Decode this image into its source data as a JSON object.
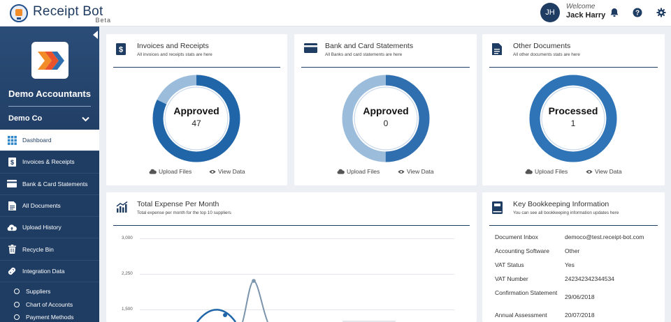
{
  "app": {
    "name": "Receipt Bot",
    "edition": "Beta"
  },
  "user": {
    "initials": "JH",
    "welcome": "Welcome",
    "name": "Jack Harry"
  },
  "header_icons": [
    "bell-icon",
    "help-icon",
    "gear-icon"
  ],
  "sidebar": {
    "company": "Demo Accountants",
    "client": "Demo Co",
    "items": [
      {
        "label": "Dashboard",
        "icon": "grid-icon",
        "active": true
      },
      {
        "label": "Invoices & Receipts",
        "icon": "invoice-icon"
      },
      {
        "label": "Bank & Card Statements",
        "icon": "card-icon"
      },
      {
        "label": "All Documents",
        "icon": "document-icon"
      },
      {
        "label": "Upload History",
        "icon": "cloud-upload-icon"
      },
      {
        "label": "Recycle Bin",
        "icon": "trash-icon"
      },
      {
        "label": "Integration Data",
        "icon": "link-icon"
      }
    ],
    "sub_items": [
      {
        "label": "Suppliers"
      },
      {
        "label": "Chart of Accounts"
      },
      {
        "label": "Payment Methods"
      }
    ]
  },
  "cards": [
    {
      "title": "Invoices and Receipts",
      "subtitle": "All invoices and receipts stats are here",
      "icon": "invoice-icon",
      "status": "Approved",
      "count": "47",
      "ring_fraction": 0.82,
      "upload": "Upload Files",
      "view": "View Data"
    },
    {
      "title": "Bank and Card Statements",
      "subtitle": "All Banks and card statements are here",
      "icon": "card-icon",
      "status": "Approved",
      "count": "0",
      "ring_fraction": 0.5,
      "upload": "Upload Files",
      "view": "View Data"
    },
    {
      "title": "Other Documents",
      "subtitle": "All other documents stats are here",
      "icon": "document-icon",
      "status": "Processed",
      "count": "1",
      "ring_fraction": 1.0,
      "upload": "Upload Files",
      "view": "View Data"
    }
  ],
  "expense": {
    "title": "Total Expense Per Month",
    "subtitle": "Total expense per month for the top 10 suppliers",
    "icon": "chart-icon",
    "ticks": [
      "3,000",
      "2,250",
      "1,500"
    ]
  },
  "bookkeeping": {
    "title": "Key Bookkeeping Information",
    "subtitle": "You can see all bookkeeping information updates here",
    "icon": "book-icon",
    "rows": [
      {
        "key": "Document Inbox",
        "value": "democo@test.receipt-bot.com"
      },
      {
        "key": "Accounting Software",
        "value": "Other"
      },
      {
        "key": "VAT Status",
        "value": "Yes"
      },
      {
        "key": "VAT Number",
        "value": "242342342344534"
      },
      {
        "key": "Confirmation Statement",
        "value": "29/06/2018"
      },
      {
        "key": "Annual Assessment",
        "value": "20/07/2018"
      }
    ]
  },
  "colors": {
    "navy": "#1f3d63",
    "accent": "#2f6fb0",
    "ring_dark": "#1f65a8",
    "ring_light": "#9bbcdb"
  }
}
